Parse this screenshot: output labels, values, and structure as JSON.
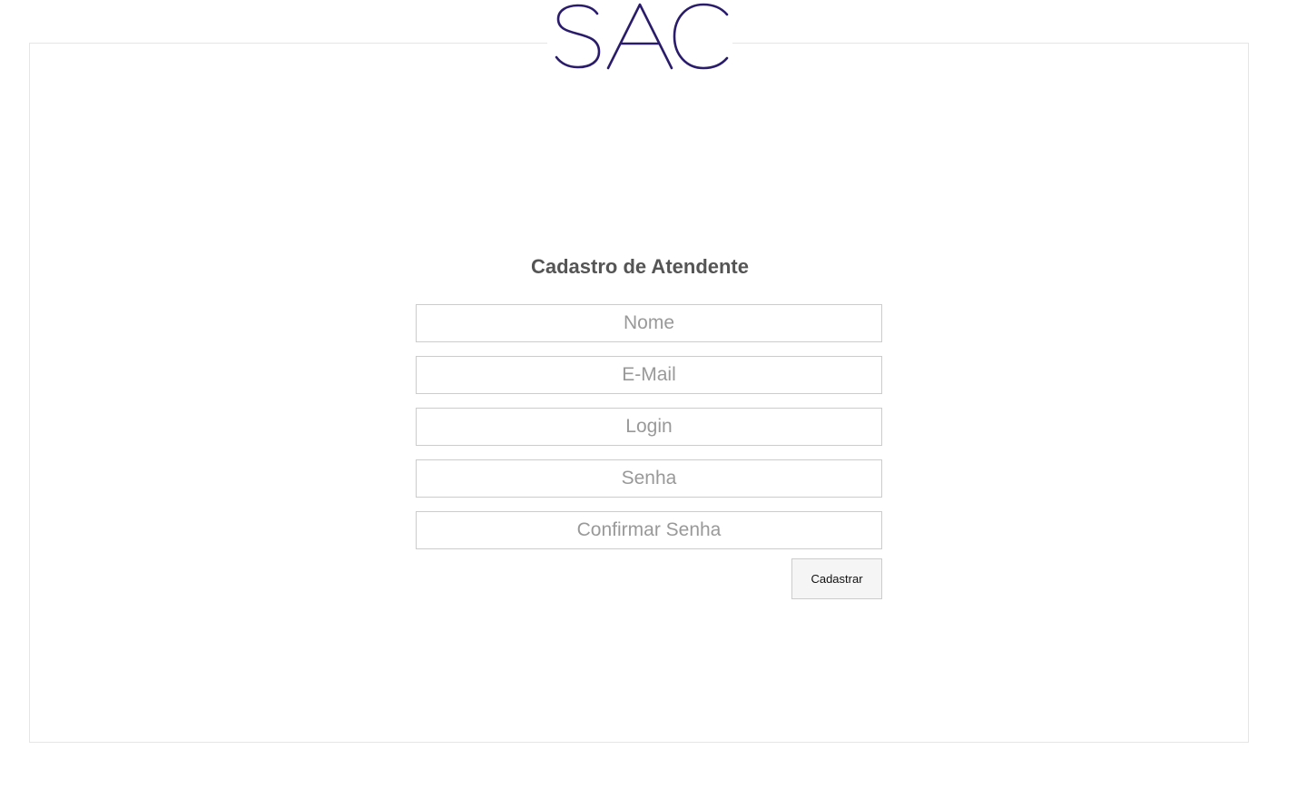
{
  "brand": {
    "logo_text": "SAC",
    "logo_color": "#2b1c6b"
  },
  "form": {
    "title": "Cadastro de Atendente",
    "fields": {
      "nome": {
        "placeholder": "Nome",
        "value": ""
      },
      "email": {
        "placeholder": "E-Mail",
        "value": ""
      },
      "login": {
        "placeholder": "Login",
        "value": ""
      },
      "senha": {
        "placeholder": "Senha",
        "value": ""
      },
      "confirmar_senha": {
        "placeholder": "Confirmar Senha",
        "value": ""
      }
    },
    "submit_label": "Cadastrar"
  }
}
